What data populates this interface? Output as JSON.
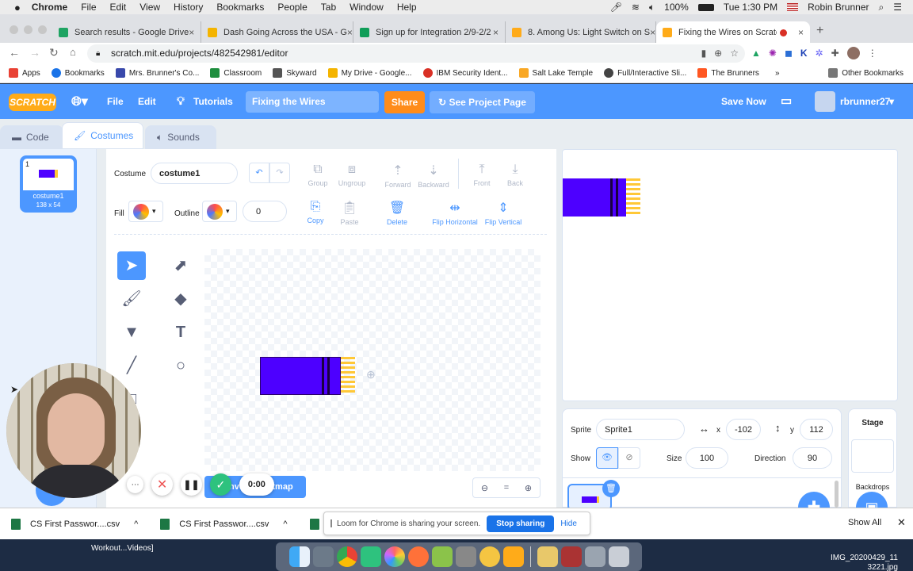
{
  "macos": {
    "app_name": "Chrome",
    "menus": [
      "File",
      "Edit",
      "View",
      "History",
      "Bookmarks",
      "People",
      "Tab",
      "Window",
      "Help"
    ],
    "battery": "100%",
    "clock": "Tue 1:30 PM",
    "user": "Robin Brunner"
  },
  "browser": {
    "tabs": [
      {
        "label": "Search results - Google Drive",
        "color": "#1fa463"
      },
      {
        "label": "Dash Going Across the USA - G",
        "color": "#f4b400"
      },
      {
        "label": "Sign up for Integration 2/9-2/2",
        "color": "#0f9d58"
      },
      {
        "label": "8. Among Us: Light Switch on S",
        "color": "#ffab19"
      },
      {
        "label": "Fixing the Wires on Scratch",
        "color": "#ffab19"
      }
    ],
    "url": "scratch.mit.edu/projects/482542981/editor",
    "bookmarks": [
      "Apps",
      "Bookmarks",
      "Mrs. Brunner's Co...",
      "Classroom",
      "Skyward",
      "My Drive - Google...",
      "IBM Security Ident...",
      "Salt Lake Temple",
      "Full/Interactive Sli...",
      "The Brunners"
    ],
    "bookmarks_more": "»",
    "other_bookmarks": "Other Bookmarks"
  },
  "scratch": {
    "logo": "SCRATCH",
    "menu": {
      "file": "File",
      "edit": "Edit",
      "tutorials": "Tutorials"
    },
    "project_title": "Fixing the Wires",
    "share": "Share",
    "see_project_page": "See Project Page",
    "save_now": "Save Now",
    "username": "rbrunner27",
    "editor_tabs": {
      "code": "Code",
      "costumes": "Costumes",
      "sounds": "Sounds"
    },
    "costume_list": [
      {
        "index": "1",
        "name": "costume1",
        "size": "138 x 54"
      }
    ],
    "paint": {
      "costume_label": "Costume",
      "costume_name": "costume1",
      "fill_label": "Fill",
      "outline_label": "Outline",
      "outline_width": "0",
      "buttons": {
        "group": "Group",
        "ungroup": "Ungroup",
        "forward": "Forward",
        "backward": "Backward",
        "front": "Front",
        "back": "Back",
        "copy": "Copy",
        "paste": "Paste",
        "delete": "Delete",
        "flip_h": "Flip Horizontal",
        "flip_v": "Flip Vertical"
      },
      "bitmap_button": "Convert to Bitmap",
      "zoom_reset": "="
    },
    "sprite": {
      "sprite_label": "Sprite",
      "name": "Sprite1",
      "x_label": "x",
      "x": "-102",
      "y_label": "y",
      "y": "112",
      "show_label": "Show",
      "size_label": "Size",
      "size": "100",
      "direction_label": "Direction",
      "direction": "90"
    },
    "stage_label": "Stage",
    "backdrops_label": "Backdrops"
  },
  "downloads": {
    "items": [
      "CS First Passwor....csv",
      "CS First Passwor....csv"
    ],
    "show_all": "Show All"
  },
  "loom": {
    "message": "Loom for Chrome is sharing your screen.",
    "stop": "Stop sharing",
    "hide": "Hide",
    "timer": "0:00"
  },
  "desktop": {
    "left_label": "Workout...Videos]",
    "file_label_1": "IMG_20200429_11",
    "file_label_2": "3221.jpg"
  },
  "colors": {
    "scratch_blue": "#4c97ff",
    "sprite_purple": "#4d00ff",
    "wire_yellow": "#ffc837",
    "share_orange": "#ff8c1a",
    "loom_blue": "#1a73e8"
  }
}
